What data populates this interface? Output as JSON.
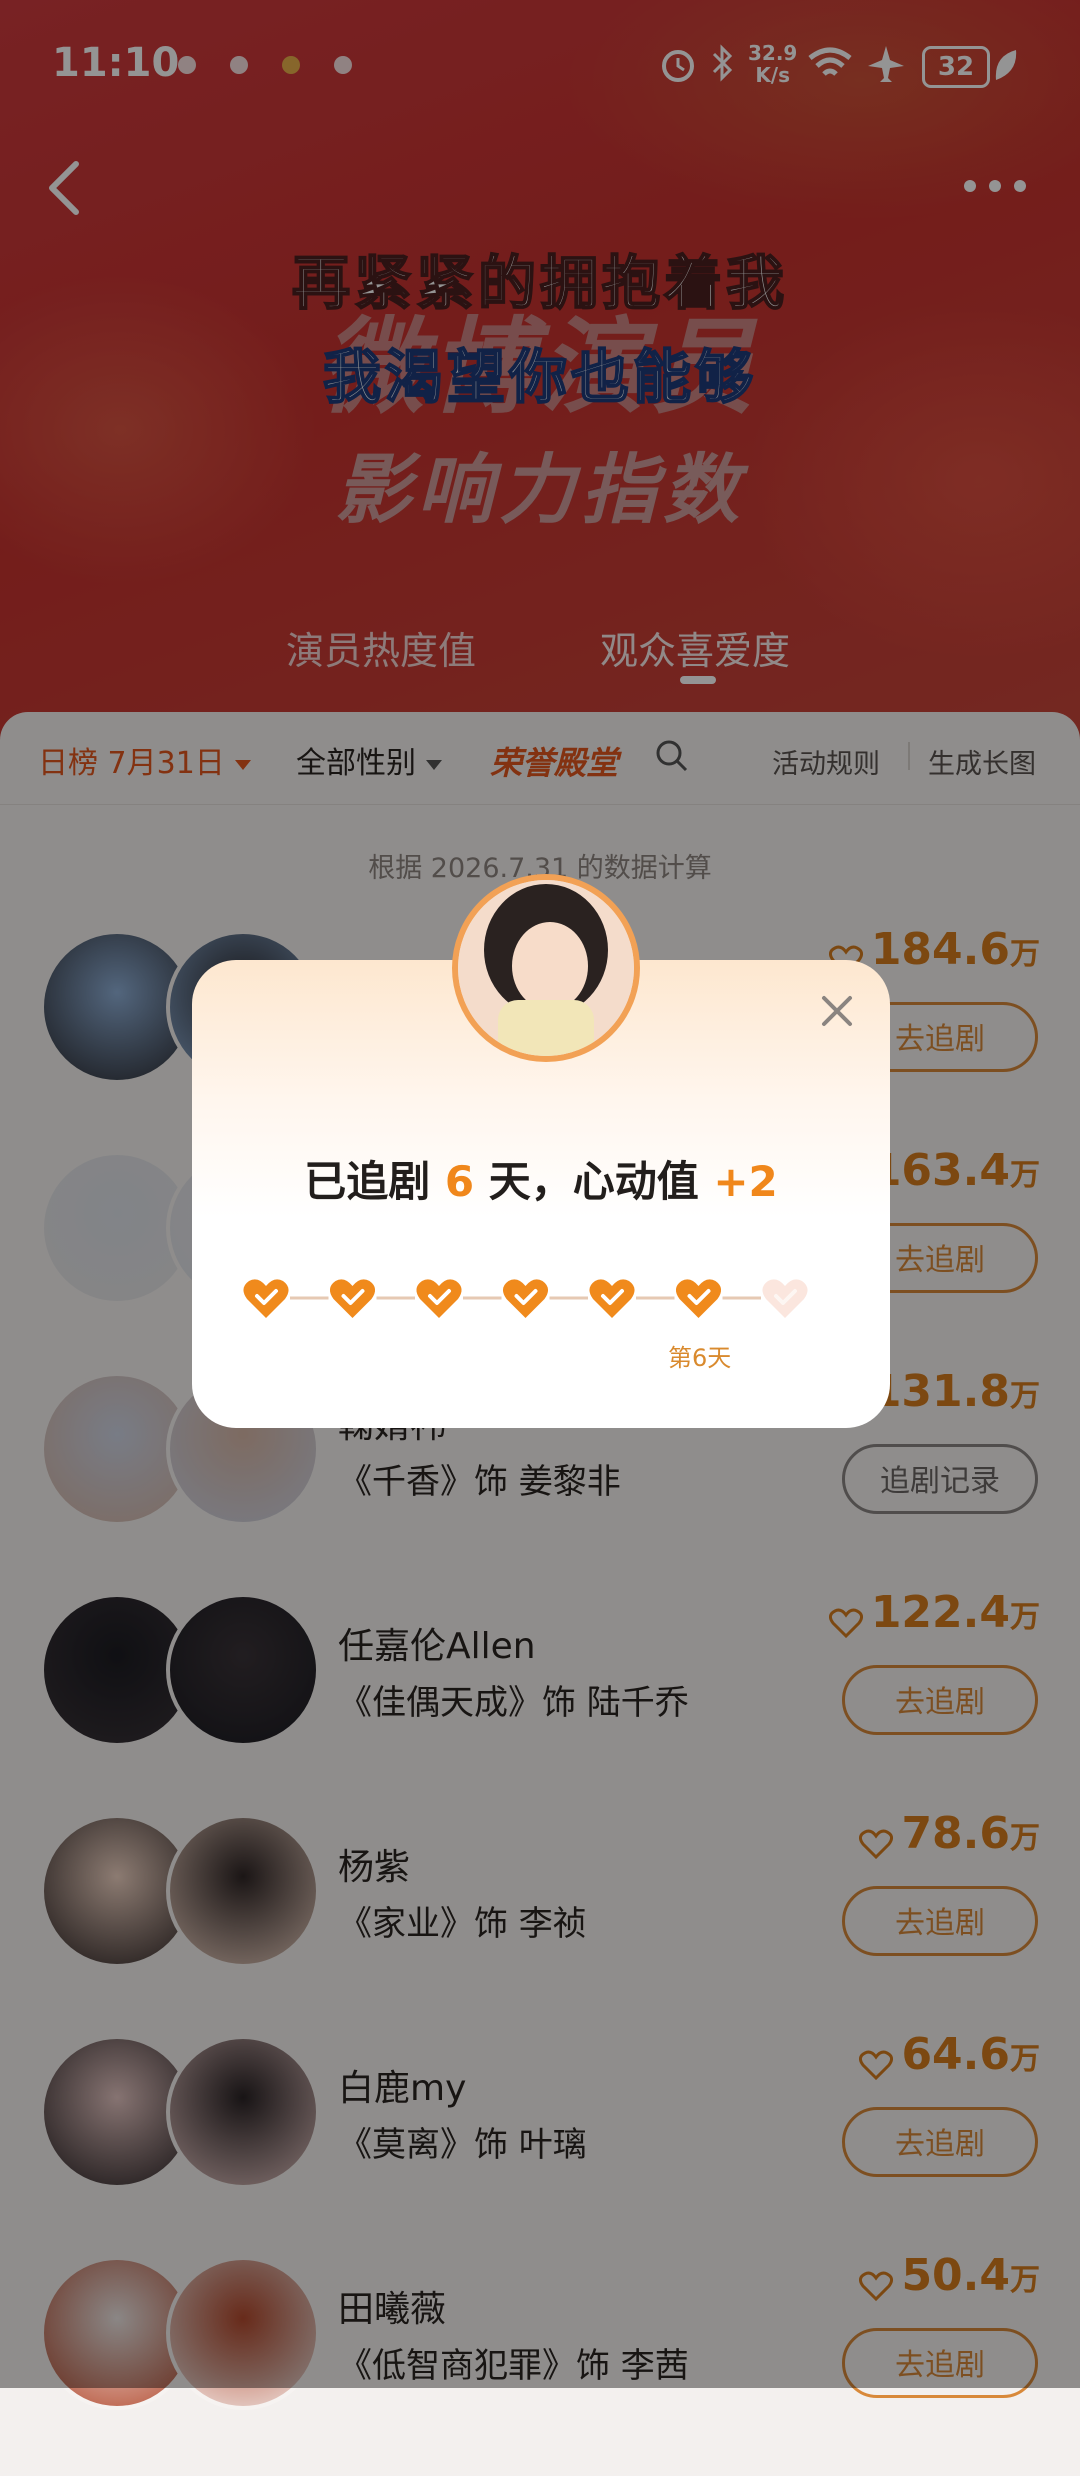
{
  "status_bar": {
    "time": "11:10",
    "net_speed_value": "32.9",
    "net_speed_unit": "K/s",
    "battery": "32"
  },
  "header": {
    "lyric_line1": "再紧紧的拥抱着我",
    "lyric_line2": "我渴望你也能够",
    "title_line1": "微博演员",
    "title_line2": "影响力指数",
    "tabs": [
      {
        "label": "演员热度值",
        "active": false
      },
      {
        "label": "观众喜爱度",
        "active": true
      }
    ]
  },
  "filters": {
    "daily": "日榜 7月31日",
    "gender": "全部性别",
    "hall": "荣誉殿堂",
    "rules": "活动规则",
    "generate": "生成长图"
  },
  "calc_note": "根据 2026.7.31 的数据计算",
  "rows": [
    {
      "name": "",
      "role": "",
      "score": "184.6",
      "unit": "万",
      "button": "去追剧"
    },
    {
      "name": "",
      "role": "",
      "score": "163.4",
      "unit": "万",
      "button": "去追剧"
    },
    {
      "name": "鞠婧祎",
      "role": "《千香》饰 姜黎非",
      "score": "131.8",
      "unit": "万",
      "button": "追剧记录"
    },
    {
      "name": "任嘉伦Allen",
      "role": "《佳偶天成》饰 陆千乔",
      "score": "122.4",
      "unit": "万",
      "button": "去追剧"
    },
    {
      "name": "杨紫",
      "role": "《家业》饰 李祯",
      "score": "78.6",
      "unit": "万",
      "button": "去追剧"
    },
    {
      "name": "白鹿my",
      "role": "《莫离》饰 叶璃",
      "score": "64.6",
      "unit": "万",
      "button": "去追剧"
    },
    {
      "name": "田曦薇",
      "role": "《低智商犯罪》饰 李茜",
      "score": "50.4",
      "unit": "万",
      "button": "去追剧"
    }
  ],
  "modal": {
    "prefix": "已追剧",
    "days": "6",
    "mid": "天，心动值",
    "plus": "+2",
    "day_label": "第6天",
    "checked_days": 6,
    "total_days": 7
  },
  "colors": {
    "accent": "#f0871b",
    "banner": "#c8322f",
    "button_border": "#d8893a"
  }
}
